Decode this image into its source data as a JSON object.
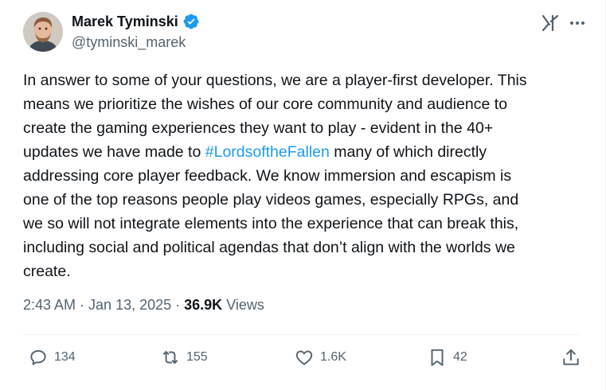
{
  "author": {
    "display_name": "Marek Tyminski",
    "handle": "@tyminski_marek",
    "verified": true,
    "verified_color": "#1d9bf0"
  },
  "header_icons": [
    "grok-icon",
    "more-options-icon"
  ],
  "tweet": {
    "lines": [
      "In answer to some of your questions, we are a player-first developer. This",
      "means we prioritize the wishes of our core community and audience to",
      "create the gaming experiences they want to play - evident in the 40+"
    ],
    "line4_before": "updates we have made to ",
    "hashtag": "#LordsoftheFallen",
    "line4_after": " many of which directly",
    "lines_after": [
      "addressing core player feedback. We know immersion and escapism is",
      "one of the top reasons people play videos games, especially RPGs, and",
      "we so will not integrate elements into the experience that can break this,",
      "including social and political agendas that don’t align with the worlds we",
      "create."
    ]
  },
  "meta": {
    "time": "2:43 AM",
    "sep1": " · ",
    "date": "Jan 13, 2025",
    "sep2": " · ",
    "views_count": "36.9K",
    "views_label": " Views"
  },
  "actions": {
    "replies": "134",
    "reposts": "155",
    "likes": "1.6K",
    "bookmarks": "42"
  },
  "colors": {
    "text": "#0f1419",
    "secondary": "#536471",
    "link": "#1d9bf0",
    "divider": "#eff3f4"
  }
}
